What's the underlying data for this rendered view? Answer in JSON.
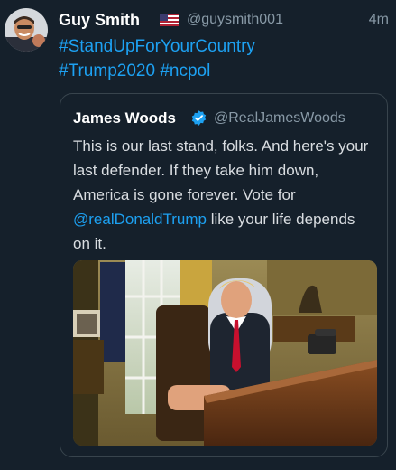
{
  "tweet": {
    "author_name": "Guy Smith",
    "flag_icon": "us-flag-icon",
    "author_handle": "@guysmith001",
    "time": "4m",
    "hashtags": [
      "#StandUpForYourCountry",
      "#Trump2020",
      "#ncpol"
    ]
  },
  "quote": {
    "author_name": "James Woods",
    "verified_icon": "verified-badge-icon",
    "author_handle": "@RealJamesWoods",
    "text_before": "This is our last stand, folks. And here's your last defender. If they take him down, America is gone forever. Vote for ",
    "mention": "@realDonaldTrump",
    "text_after": " like your life depends on it."
  },
  "colors": {
    "background": "#15202b",
    "link": "#1da1f2",
    "secondary_text": "#8899a6",
    "border": "#38444d",
    "verified": "#1da1f2"
  }
}
